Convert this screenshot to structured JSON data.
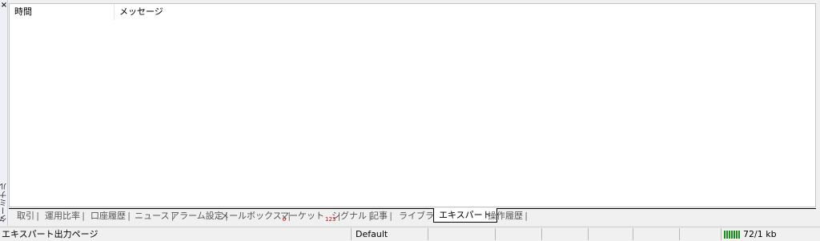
{
  "panel": {
    "close_label": "×",
    "title": "ターミナル"
  },
  "list": {
    "columns": [
      "時間",
      "メッセージ"
    ]
  },
  "tabs": [
    {
      "label": "取引",
      "badge": ""
    },
    {
      "label": "運用比率",
      "badge": ""
    },
    {
      "label": "口座履歴",
      "badge": ""
    },
    {
      "label": "ニュース",
      "badge": ""
    },
    {
      "label": "アラーム設定",
      "badge": ""
    },
    {
      "label": "メールボックス",
      "badge": "6"
    },
    {
      "label": "マーケット",
      "badge": "123"
    },
    {
      "label": "シグナル",
      "badge": ""
    },
    {
      "label": "記事",
      "badge": ""
    },
    {
      "label": "ライブラリ",
      "badge": ""
    },
    {
      "label": "エキスパート",
      "badge": "",
      "active": true
    },
    {
      "label": "操作履歴",
      "badge": ""
    }
  ],
  "status": {
    "help_text": "エキスパート出力ページ",
    "profile": "Default",
    "traffic": "72/1 kb"
  },
  "colors": {
    "badge": "#d00000",
    "connection": "#1a8f1a"
  },
  "icons": {
    "close": "close-icon",
    "connection": "connection-status-icon"
  }
}
